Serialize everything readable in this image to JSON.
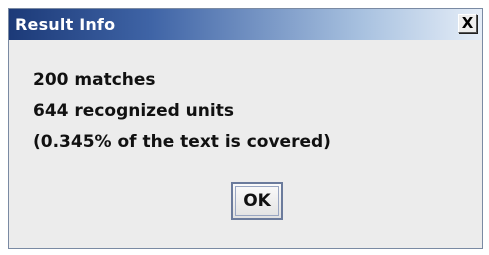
{
  "dialog": {
    "title": "Result Info",
    "close_label": "X",
    "lines": [
      "200 matches",
      "644 recognized units",
      "(0.345% of the text is covered)"
    ],
    "ok_label": "OK"
  },
  "colors": {
    "title_start": "#1c3a78",
    "title_end": "#e6eef8",
    "dialog_bg": "#ececec"
  },
  "icons": {
    "close": "close-icon"
  }
}
